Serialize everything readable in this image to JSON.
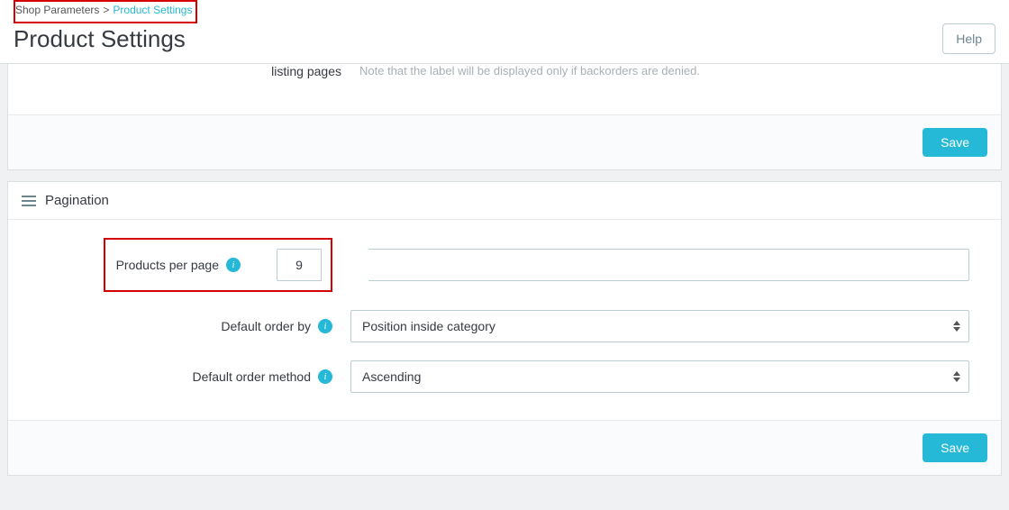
{
  "breadcrumb": {
    "parent": "Shop Parameters",
    "sep": ">",
    "current": "Product Settings"
  },
  "page_title": "Product Settings",
  "help": "Help",
  "panel_a": {
    "label": "listing pages",
    "note": "Note that the label will be displayed only if backorders are denied.",
    "save": "Save"
  },
  "pagination_panel": {
    "title": "Pagination",
    "products_per_page_label": "Products per page",
    "products_per_page_value": "9",
    "order_by_label": "Default order by",
    "order_by_value": "Position inside category",
    "order_method_label": "Default order method",
    "order_method_value": "Ascending",
    "save": "Save"
  }
}
